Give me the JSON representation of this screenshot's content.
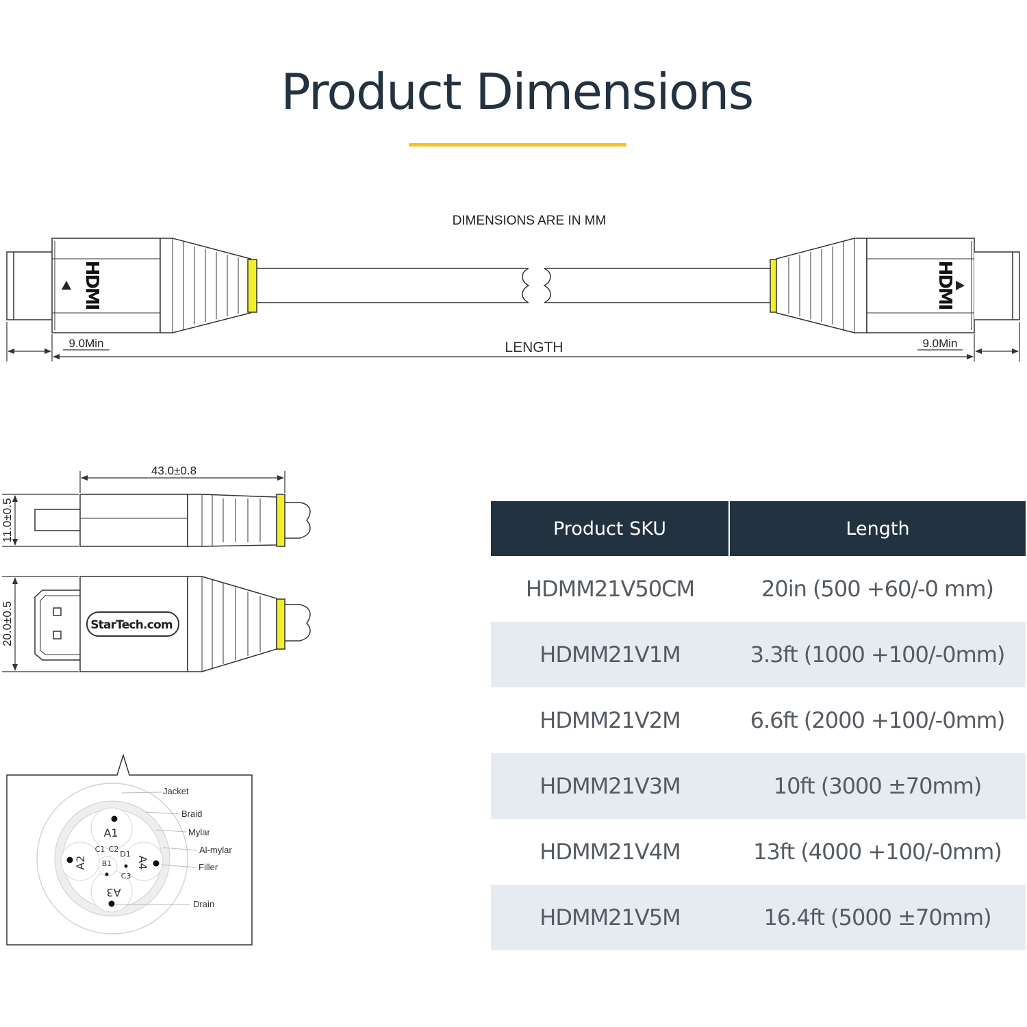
{
  "title": "Product Dimensions",
  "colors": {
    "accent_yellow": "#f3c31c",
    "connector_yellow": "#f2ee2a",
    "table_header": "#233241",
    "table_stripe": "#e6ebf2",
    "line": "#333333"
  },
  "diagram": {
    "units_note": "DIMENSIONS ARE IN MM",
    "connector_logo": "HDMI",
    "brand_logo": "StarTech.com",
    "length_label": "LENGTH",
    "plug_min_left": "9.0Min",
    "plug_min_right": "9.0Min",
    "side_length_dim": "43.0±0.8",
    "side_height_dim": "11.0±0.5",
    "front_height_dim": "20.0±0.5",
    "cross_section": {
      "layers": [
        "Jacket",
        "Braid",
        "Mylar",
        "Al-mylar",
        "Filler",
        "Drain"
      ],
      "pairs": [
        "A1",
        "A2",
        "A3",
        "A4"
      ],
      "cores": [
        "B1",
        "C1",
        "C2",
        "C3",
        "D1"
      ]
    }
  },
  "table": {
    "headers": [
      "Product SKU",
      "Length"
    ],
    "rows": [
      {
        "sku": "HDMM21V50CM",
        "length": "20in (500 +60/-0 mm)"
      },
      {
        "sku": "HDMM21V1M",
        "length": "3.3ft (1000 +100/-0mm)"
      },
      {
        "sku": "HDMM21V2M",
        "length": "6.6ft (2000 +100/-0mm)"
      },
      {
        "sku": "HDMM21V3M",
        "length": "10ft (3000 ±70mm)"
      },
      {
        "sku": "HDMM21V4M",
        "length": "13ft (4000 +100/-0mm)"
      },
      {
        "sku": "HDMM21V5M",
        "length": "16.4ft (5000 ±70mm)"
      }
    ]
  }
}
